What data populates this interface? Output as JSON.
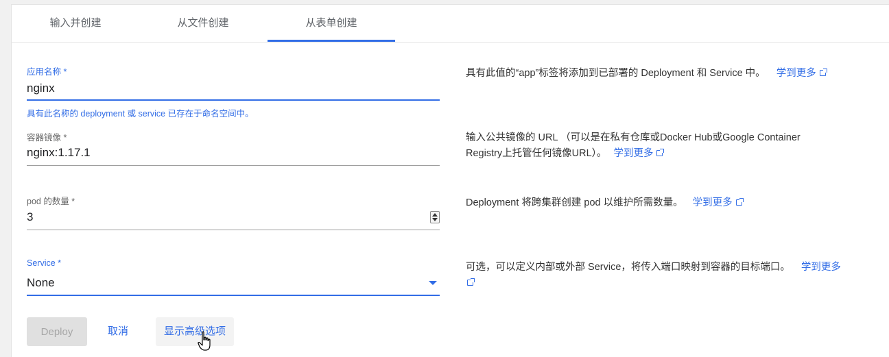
{
  "tabs": [
    {
      "label": "输入并创建"
    },
    {
      "label": "从文件创建"
    },
    {
      "label": "从表单创建",
      "active": true
    }
  ],
  "form": {
    "app_name": {
      "label": "应用名称 *",
      "value": "nginx",
      "hint": "具有此名称的 deployment 或 service 已存在于命名空间中。",
      "help": "具有此值的“app”标签将添加到已部署的 Deployment 和 Service 中。",
      "link": "学到更多"
    },
    "image": {
      "label": "容器镜像 *",
      "value": "nginx:1.17.1",
      "help_line1": "输入公共镜像的 URL （可以是在私有仓库或Docker Hub或Google Container",
      "help_line2": "Registry上托管任何镜像URL）。",
      "link": "学到更多"
    },
    "pods": {
      "label": "pod 的数量 *",
      "value": "3",
      "help": "Deployment 将跨集群创建 pod 以维护所需数量。",
      "link": "学到更多"
    },
    "service": {
      "label": "Service *",
      "value": "None",
      "help": "可选，可以定义内部或外部 Service，将传入端口映射到容器的目标端口。",
      "link": "学到更多"
    }
  },
  "actions": {
    "deploy": "Deploy",
    "cancel": "取消",
    "advanced": "显示高级选项"
  },
  "colors": {
    "accent": "#326de6",
    "disabled_bg": "#e0e0e0",
    "disabled_text": "#a6a6a6"
  },
  "icons": [
    "external-link-icon",
    "stepper-icon",
    "dropdown-caret-icon",
    "hand-cursor-icon"
  ]
}
